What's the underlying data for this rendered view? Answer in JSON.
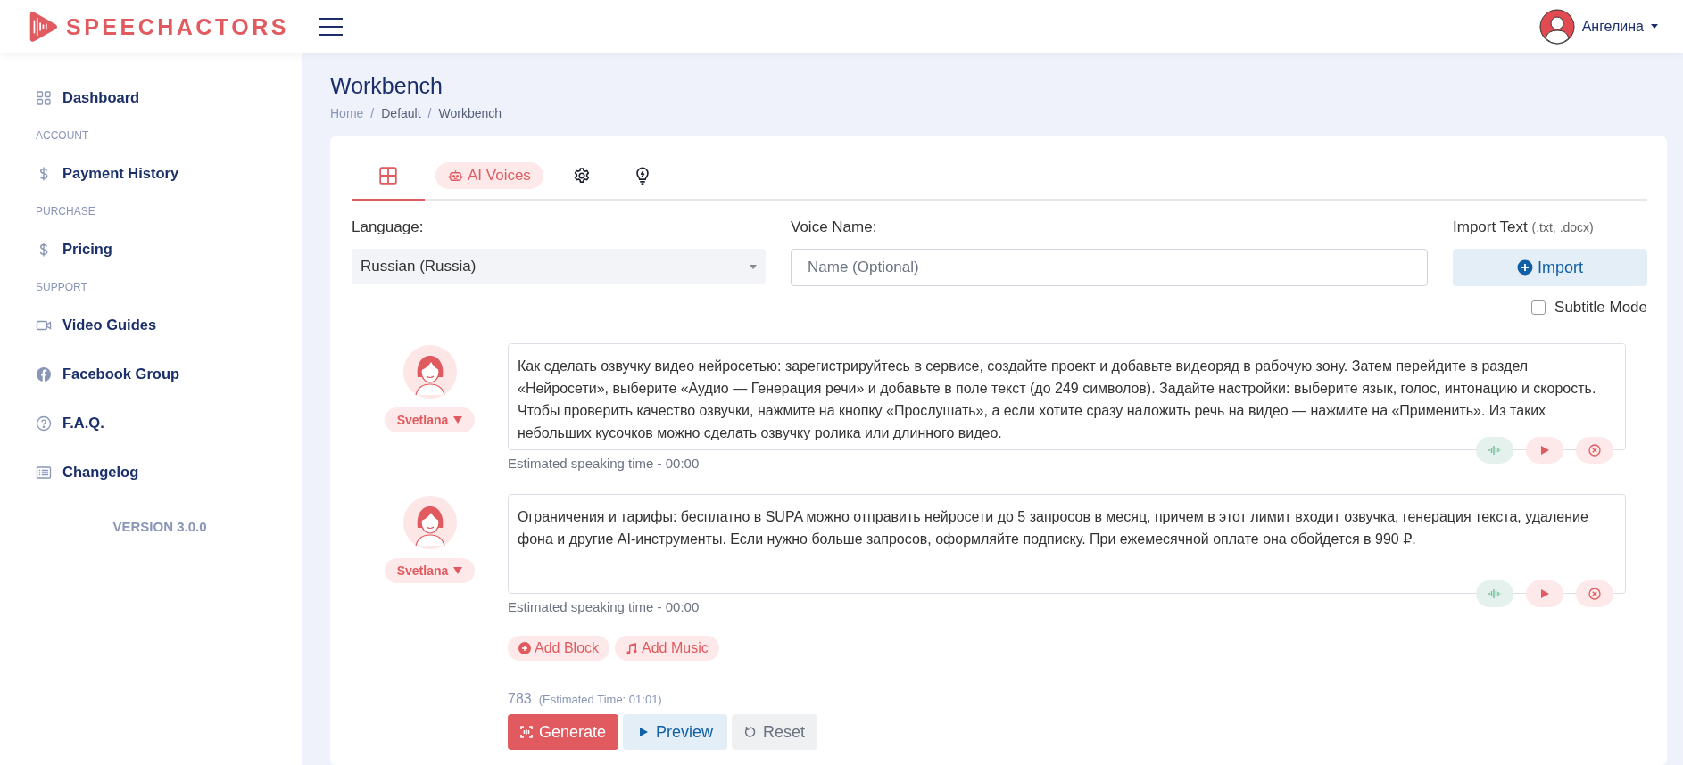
{
  "brand": {
    "name": "SPEECHACTORS"
  },
  "user": {
    "name": "Ангелина"
  },
  "sidebar": {
    "items": [
      {
        "kind": "link",
        "label": "Dashboard"
      },
      {
        "kind": "section",
        "label": "ACCOUNT"
      },
      {
        "kind": "link",
        "label": "Payment History"
      },
      {
        "kind": "section",
        "label": "PURCHASE"
      },
      {
        "kind": "link",
        "label": "Pricing"
      },
      {
        "kind": "section",
        "label": "SUPPORT"
      },
      {
        "kind": "link",
        "label": "Video Guides"
      },
      {
        "kind": "link",
        "label": "Facebook Group"
      },
      {
        "kind": "link",
        "label": "F.A.Q."
      },
      {
        "kind": "link",
        "label": "Changelog"
      }
    ],
    "version": "VERSION 3.0.0"
  },
  "page": {
    "title": "Workbench",
    "breadcrumb": [
      "Home",
      "Default",
      "Workbench"
    ],
    "breadcrumb_separator": "/"
  },
  "tabs": [
    {
      "selected": true
    },
    {
      "label": "AI Voices",
      "selected": false
    },
    {
      "selected": false
    },
    {
      "selected": false
    }
  ],
  "form": {
    "language": {
      "label": "Language:",
      "value": "Russian (Russia)"
    },
    "voice_name": {
      "label": "Voice Name:",
      "placeholder": "Name (Optional)"
    },
    "import": {
      "label": "Import Text",
      "hint": "(.txt, .docx)",
      "button": "Import"
    },
    "subtitle_mode": {
      "label": "Subtitle Mode",
      "checked": false
    }
  },
  "blocks": [
    {
      "voice": "Svetlana",
      "text": "Как сделать озвучку видео нейросетью: зарегистрируйтесь в сервисе, создайте проект и добавьте видеоряд в рабочую зону. Затем перейдите в раздел «Нейросети», выберите «Аудио — Генерация речи» и добавьте в поле текст (до 249 символов). Задайте настройки: выберите язык, голос, интонацию и скорость. Чтобы проверить качество озвучки, нажмите на кнопку «Прослушать», а если хотите сразу наложить речь на видео — нажмите на «Применить». Из таких небольших кусочков можно сделать озвучку ролика или длинного видео.",
      "estimate": "Estimated speaking time - 00:00"
    },
    {
      "voice": "Svetlana",
      "text": "Ограничения и тарифы: бесплатно в SUPA можно отправить нейросети до 5 запросов в месяц, причем в этот лимит входит озвучка, генерация текста, удаление фона и другие AI-инструменты. Если нужно больше запросов, оформляйте подписку. При ежемесячной оплате она обойдется в 990 ₽.",
      "estimate": "Estimated speaking time - 00:00"
    }
  ],
  "add_buttons": [
    "Add Block",
    "Add Music"
  ],
  "summary": {
    "count": "783",
    "estimated_time": "(Estimated Time: 01:01)"
  },
  "buttons": [
    "Generate",
    "Preview",
    "Reset"
  ]
}
